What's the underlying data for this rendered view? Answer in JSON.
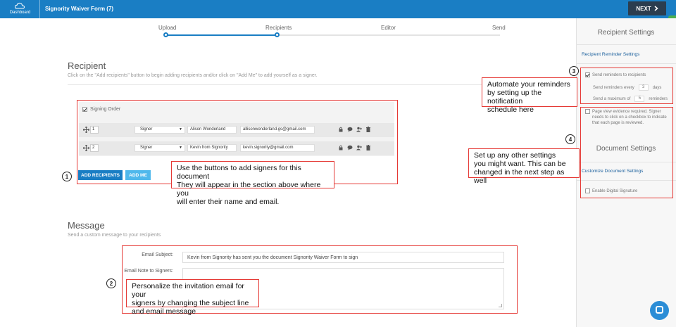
{
  "header": {
    "logo_label": "Dashboard",
    "doc_title": "Signority Waiver Form (7)",
    "next_label": "NEXT"
  },
  "steps": [
    {
      "label": "Upload"
    },
    {
      "label": "Recipients"
    },
    {
      "label": "Editor"
    },
    {
      "label": "Send"
    }
  ],
  "recipient": {
    "title": "Recipient",
    "subtitle": "Click on the \"Add recipients\" button to begin adding recipients and/or click on \"Add Me\" to add yourself as a signer.",
    "signing_order_label": "Signing Order",
    "rows": [
      {
        "order": "1",
        "role": "Signer",
        "name": "Alison Wonderland",
        "email": "allisonwonderland.gs@gmail.com"
      },
      {
        "order": "2",
        "role": "Signer",
        "name": "Kevin from Signority",
        "email": "kevin.signority@gmail.com"
      }
    ],
    "add_recipients_label": "ADD RECIPIENTS",
    "add_me_label": "ADD ME"
  },
  "message": {
    "title": "Message",
    "subtitle": "Send a custom message to your recipients",
    "subject_label": "Email Subject:",
    "subject_value": "Kevin from Signority has sent you the document Signority Waiver Form to sign",
    "note_label": "Email Note to Signers:",
    "note_value": ""
  },
  "sidebar": {
    "recipient_settings_title": "Recipient Settings",
    "reminder_settings_label": "Recipient Reminder Settings",
    "send_reminders_label": "Send reminders to recipients",
    "every_prefix": "Send reminders every",
    "every_value": "3",
    "every_suffix": "days",
    "max_prefix": "Send a maximum of",
    "max_value": "5",
    "max_suffix": "reminders",
    "page_view_label": "Page view evidence required. Signer needs to click on a checkbox to indicate that each page is reviewed.",
    "document_settings_title": "Document Settings",
    "customize_label": "Customize Document Settings",
    "digital_signature_label": "Enable Digital Signature"
  },
  "annotations": {
    "c1": {
      "num": "1",
      "lines": [
        "Use the buttons to add signers for this document",
        "They will appear in the section above where you",
        "will enter their name and email."
      ]
    },
    "c2": {
      "num": "2",
      "lines": [
        "Personalize the invitation email for your",
        "signers by changing the subject line",
        "and email message"
      ]
    },
    "c3": {
      "num": "3",
      "lines": [
        "Automate your reminders",
        "by setting up the notification",
        "schedule here"
      ]
    },
    "c4": {
      "num": "4",
      "lines": [
        "Set up any other settings",
        "you might want. This can be",
        "changed in the next step as well"
      ]
    }
  },
  "colors": {
    "primary": "#1a7ec4",
    "secondary_button": "#4fb8ec",
    "next_button": "#2b3d4f",
    "annotation_red": "#e53935"
  }
}
